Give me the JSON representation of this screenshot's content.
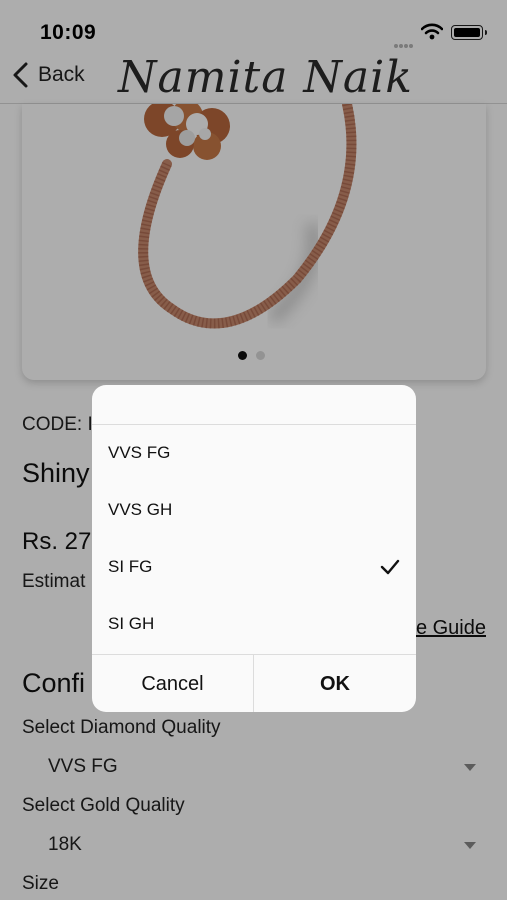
{
  "status_bar": {
    "time": "10:09"
  },
  "nav": {
    "back_label": "Back",
    "brand": "Namita Naik"
  },
  "carousel": {
    "active_dot_color": "#111111",
    "inactive_dot_color": "#d9d9d9"
  },
  "product": {
    "code_label": "CODE: I",
    "title": "Shiny",
    "price": "Rs. 27",
    "estimate_label": "Estimat"
  },
  "size_guide_link": "e Guide",
  "config": {
    "heading": "Confi",
    "diamond_quality_label": "Select Diamond Quality",
    "diamond_quality_value": "VVS FG",
    "gold_quality_label": "Select Gold Quality",
    "gold_quality_value": "18K",
    "size_label": "Size"
  },
  "dialog": {
    "options": [
      {
        "label": "VVS FG",
        "selected": false
      },
      {
        "label": "VVS GH",
        "selected": false
      },
      {
        "label": "SI FG",
        "selected": true
      },
      {
        "label": "SI GH",
        "selected": false
      }
    ],
    "cancel_label": "Cancel",
    "ok_label": "OK"
  },
  "colors": {
    "overlay": "rgba(0,0,0,0.32)",
    "bracelet": "#c8896e",
    "dialog_bg": "#fafafa"
  },
  "icons": {
    "back": "chevron-left-icon",
    "wifi": "wifi-icon",
    "battery": "battery-icon",
    "signal": "signal-icon",
    "check": "checkmark-icon",
    "dropdown": "triangle-down-icon"
  }
}
